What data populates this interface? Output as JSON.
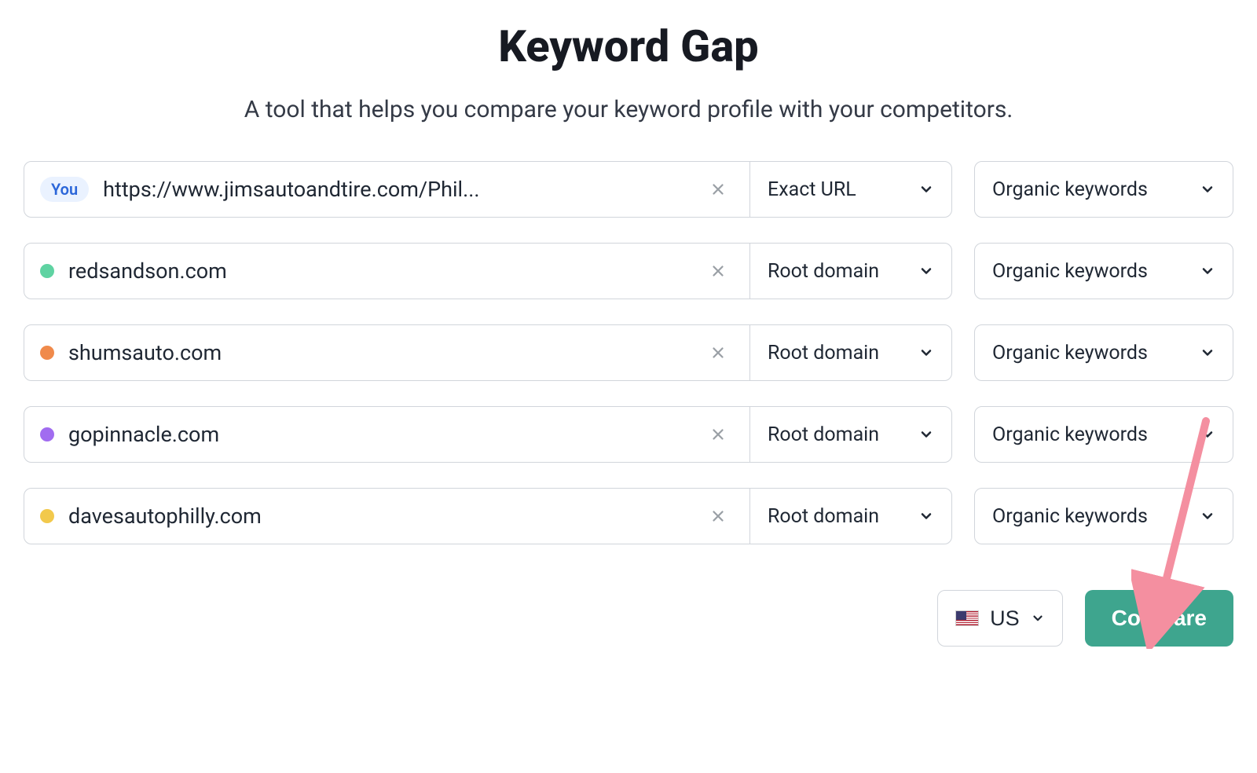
{
  "header": {
    "title": "Keyword Gap",
    "subtitle": "A tool that helps you compare your keyword profile with your competitors."
  },
  "you_badge": "You",
  "rows": [
    {
      "domain": "https://www.jimsautoandtire.com/Phil...",
      "scope": "Exact URL",
      "keywords": "Organic keywords",
      "is_you": true,
      "dot_color": null
    },
    {
      "domain": "redsandson.com",
      "scope": "Root domain",
      "keywords": "Organic keywords",
      "is_you": false,
      "dot_color": "#5fd3a2"
    },
    {
      "domain": "shumsauto.com",
      "scope": "Root domain",
      "keywords": "Organic keywords",
      "is_you": false,
      "dot_color": "#f08a4b"
    },
    {
      "domain": "gopinnacle.com",
      "scope": "Root domain",
      "keywords": "Organic keywords",
      "is_you": false,
      "dot_color": "#a16cf0"
    },
    {
      "domain": "davesautophilly.com",
      "scope": "Root domain",
      "keywords": "Organic keywords",
      "is_you": false,
      "dot_color": "#f2c94c"
    }
  ],
  "footer": {
    "country": "US",
    "compare": "Compare"
  },
  "annotation": {
    "arrow_color": "#f48fa0"
  }
}
